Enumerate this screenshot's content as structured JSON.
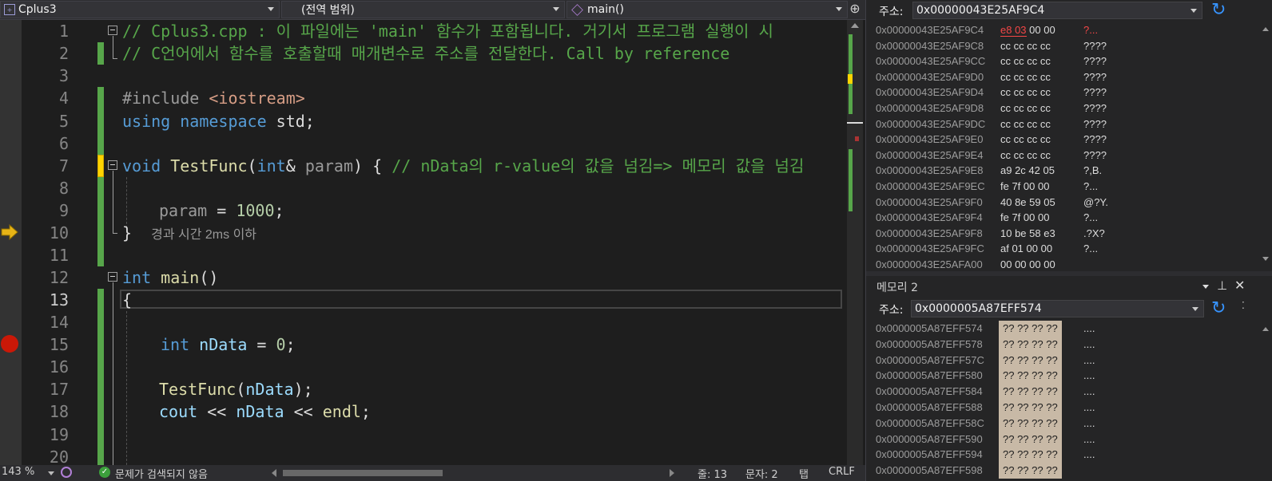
{
  "navbar": {
    "project": "Cplus3",
    "scope": "(전역 범위)",
    "member": "main()"
  },
  "editor": {
    "line_numbers": [
      "1",
      "2",
      "3",
      "4",
      "5",
      "6",
      "7",
      "8",
      "9",
      "10",
      "11",
      "12",
      "13",
      "14",
      "15",
      "16",
      "17",
      "18",
      "19",
      "20"
    ],
    "current_line": "13",
    "lines": {
      "l1": "// Cplus3.cpp : 이 파일에는 'main' 함수가 포함됩니다. 거기서 프로그램 실행이 시",
      "l2": "// C언어에서 함수를 호출할때 매개변수로 주소를 전달한다. Call by reference",
      "l4_a": "#include ",
      "l4_b": "<iostream>",
      "l5_a": "using",
      "l5_b": "namespace",
      "l5_c": " std;",
      "l7_a": "void",
      "l7_b": "TestFunc",
      "l7_c": "(",
      "l7_d": "int",
      "l7_e": "& ",
      "l7_f": "param",
      "l7_g": ") { ",
      "l7_h": "// nData의 r-value의 값을 넘김=> 메모리 값을 넘김",
      "l9_a": "param",
      "l9_b": " = ",
      "l9_c": "1000",
      "l9_d": ";",
      "l10_a": "}",
      "l10_hint": "경과 시간 2ms 이하",
      "l12_a": "int",
      "l12_b": "main",
      "l12_c": "()",
      "l13_a": "{",
      "l15_a": "int",
      "l15_b": "nData",
      "l15_c": " = ",
      "l15_d": "0",
      "l15_e": ";",
      "l17_a": "TestFunc",
      "l17_b": "(",
      "l17_c": "nData",
      "l17_d": ");",
      "l18_a": "cout",
      "l18_b": " << ",
      "l18_c": "nData",
      "l18_d": " << ",
      "l18_e": "endl",
      "l18_f": ";"
    }
  },
  "status": {
    "zoom": "143 %",
    "issues": "문제가 검색되지 않음",
    "line": "줄: 13",
    "col": "문자: 2",
    "tab": "탭",
    "eol": "CRLF"
  },
  "memory1": {
    "address_label": "주소:",
    "address": "0x00000043E25AF9C4",
    "rows": [
      {
        "addr": "0x00000043E25AF9C4",
        "b1": "e8 03",
        "b2": " 00 00",
        "ascii": "?..."
      },
      {
        "addr": "0x00000043E25AF9C8",
        "b1": "",
        "b2": "cc cc cc cc",
        "ascii": "????"
      },
      {
        "addr": "0x00000043E25AF9CC",
        "b1": "",
        "b2": "cc cc cc cc",
        "ascii": "????"
      },
      {
        "addr": "0x00000043E25AF9D0",
        "b1": "",
        "b2": "cc cc cc cc",
        "ascii": "????"
      },
      {
        "addr": "0x00000043E25AF9D4",
        "b1": "",
        "b2": "cc cc cc cc",
        "ascii": "????"
      },
      {
        "addr": "0x00000043E25AF9D8",
        "b1": "",
        "b2": "cc cc cc cc",
        "ascii": "????"
      },
      {
        "addr": "0x00000043E25AF9DC",
        "b1": "",
        "b2": "cc cc cc cc",
        "ascii": "????"
      },
      {
        "addr": "0x00000043E25AF9E0",
        "b1": "",
        "b2": "cc cc cc cc",
        "ascii": "????"
      },
      {
        "addr": "0x00000043E25AF9E4",
        "b1": "",
        "b2": "cc cc cc cc",
        "ascii": "????"
      },
      {
        "addr": "0x00000043E25AF9E8",
        "b1": "",
        "b2": "a9 2c 42 05",
        "ascii": "?,B."
      },
      {
        "addr": "0x00000043E25AF9EC",
        "b1": "",
        "b2": "fe 7f 00 00",
        "ascii": "?..."
      },
      {
        "addr": "0x00000043E25AF9F0",
        "b1": "",
        "b2": "40 8e 59 05",
        "ascii": "@?Y."
      },
      {
        "addr": "0x00000043E25AF9F4",
        "b1": "",
        "b2": "fe 7f 00 00",
        "ascii": "?..."
      },
      {
        "addr": "0x00000043E25AF9F8",
        "b1": "",
        "b2": "10 be 58 e3",
        "ascii": ".?X?"
      },
      {
        "addr": "0x00000043E25AF9FC",
        "b1": "",
        "b2": "af 01 00 00",
        "ascii": "?..."
      },
      {
        "addr": "0x00000043E25AFA00",
        "b1": "",
        "b2": "00 00 00 00",
        "ascii": ""
      }
    ]
  },
  "memory2": {
    "title": "메모리 2",
    "address_label": "주소:",
    "address": "0x0000005A87EFF574",
    "rows": [
      {
        "addr": "0x0000005A87EFF574",
        "bytes": "?? ?? ?? ??",
        "ascii": "...."
      },
      {
        "addr": "0x0000005A87EFF578",
        "bytes": "?? ?? ?? ??",
        "ascii": "...."
      },
      {
        "addr": "0x0000005A87EFF57C",
        "bytes": "?? ?? ?? ??",
        "ascii": "...."
      },
      {
        "addr": "0x0000005A87EFF580",
        "bytes": "?? ?? ?? ??",
        "ascii": "...."
      },
      {
        "addr": "0x0000005A87EFF584",
        "bytes": "?? ?? ?? ??",
        "ascii": "...."
      },
      {
        "addr": "0x0000005A87EFF588",
        "bytes": "?? ?? ?? ??",
        "ascii": "...."
      },
      {
        "addr": "0x0000005A87EFF58C",
        "bytes": "?? ?? ?? ??",
        "ascii": "...."
      },
      {
        "addr": "0x0000005A87EFF590",
        "bytes": "?? ?? ?? ??",
        "ascii": "...."
      },
      {
        "addr": "0x0000005A87EFF594",
        "bytes": "?? ?? ?? ??",
        "ascii": "...."
      },
      {
        "addr": "0x0000005A87EFF598",
        "bytes": "?? ?? ?? ??",
        "ascii": ""
      }
    ]
  },
  "colors": {
    "keyword": "#569cd6",
    "function": "#dcdcaa",
    "comment": "#57a64a",
    "string": "#d69d85",
    "number": "#b5cea8",
    "breakpoint": "#e51400",
    "instruction_pointer": "#e7b416",
    "changed_byte": "#f44747"
  }
}
